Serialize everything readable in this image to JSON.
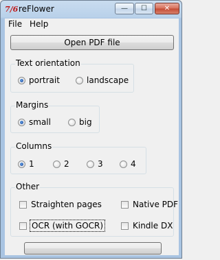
{
  "window": {
    "title": "reFlower",
    "app_icon_glyph": "7/6",
    "minimize_glyph": "—",
    "maximize_glyph": "☐",
    "close_glyph": "✕"
  },
  "menu": {
    "file": "File",
    "help": "Help"
  },
  "open_button": "Open PDF file",
  "orientation": {
    "title": "Text orientation",
    "options": [
      {
        "label": "portrait",
        "selected": true
      },
      {
        "label": "landscape",
        "selected": false
      }
    ]
  },
  "margins": {
    "title": "Margins",
    "options": [
      {
        "label": "small",
        "selected": true
      },
      {
        "label": "big",
        "selected": false
      }
    ]
  },
  "columns": {
    "title": "Columns",
    "options": [
      {
        "label": "1",
        "selected": true
      },
      {
        "label": "2",
        "selected": false
      },
      {
        "label": "3",
        "selected": false
      },
      {
        "label": "4",
        "selected": false
      }
    ]
  },
  "other": {
    "title": "Other",
    "checks": [
      {
        "label": "Straighten pages",
        "checked": false
      },
      {
        "label": "Native PDF",
        "checked": false
      },
      {
        "label": "OCR (with GOCR)",
        "checked": false
      },
      {
        "label": "Kindle DX",
        "checked": false
      }
    ]
  },
  "bottom_button": ""
}
